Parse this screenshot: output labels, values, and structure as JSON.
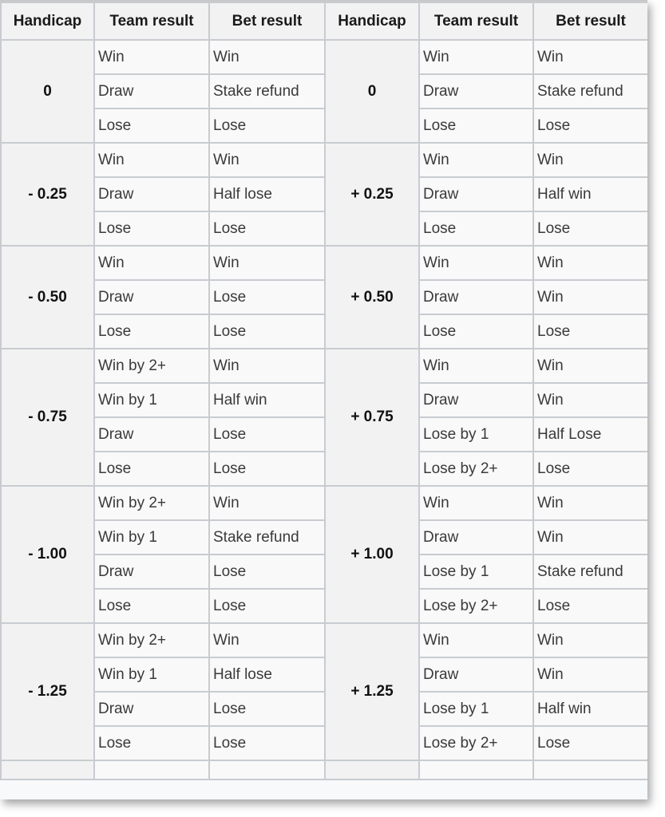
{
  "headers": [
    "Handicap",
    "Team result",
    "Bet result",
    "Handicap",
    "Team result",
    "Bet result"
  ],
  "groups": [
    {
      "left": {
        "handicap": "0",
        "rows": [
          [
            "Win",
            "Win"
          ],
          [
            "Draw",
            "Stake refund"
          ],
          [
            "Lose",
            "Lose"
          ]
        ]
      },
      "right": {
        "handicap": "0",
        "rows": [
          [
            "Win",
            "Win"
          ],
          [
            "Draw",
            "Stake refund"
          ],
          [
            "Lose",
            "Lose"
          ]
        ]
      }
    },
    {
      "left": {
        "handicap": "- 0.25",
        "rows": [
          [
            "Win",
            "Win"
          ],
          [
            "Draw",
            "Half lose"
          ],
          [
            "Lose",
            "Lose"
          ]
        ]
      },
      "right": {
        "handicap": "+ 0.25",
        "rows": [
          [
            "Win",
            "Win"
          ],
          [
            "Draw",
            "Half win"
          ],
          [
            "Lose",
            "Lose"
          ]
        ]
      }
    },
    {
      "left": {
        "handicap": "- 0.50",
        "rows": [
          [
            "Win",
            "Win"
          ],
          [
            "Draw",
            "Lose"
          ],
          [
            "Lose",
            "Lose"
          ]
        ]
      },
      "right": {
        "handicap": "+ 0.50",
        "rows": [
          [
            "Win",
            "Win"
          ],
          [
            "Draw",
            "Win"
          ],
          [
            "Lose",
            "Lose"
          ]
        ]
      }
    },
    {
      "left": {
        "handicap": "- 0.75",
        "rows": [
          [
            "Win by 2+",
            "Win"
          ],
          [
            "Win by 1",
            "Half win"
          ],
          [
            "Draw",
            "Lose"
          ],
          [
            "Lose",
            "Lose"
          ]
        ]
      },
      "right": {
        "handicap": "+ 0.75",
        "rows": [
          [
            "Win",
            "Win"
          ],
          [
            "Draw",
            "Win"
          ],
          [
            "Lose by 1",
            "Half Lose"
          ],
          [
            "Lose by 2+",
            "Lose"
          ]
        ]
      }
    },
    {
      "left": {
        "handicap": "- 1.00",
        "rows": [
          [
            "Win by 2+",
            "Win"
          ],
          [
            "Win by 1",
            "Stake refund"
          ],
          [
            "Draw",
            "Lose"
          ],
          [
            "Lose",
            "Lose"
          ]
        ]
      },
      "right": {
        "handicap": "+ 1.00",
        "rows": [
          [
            "Win",
            "Win"
          ],
          [
            "Draw",
            "Win"
          ],
          [
            "Lose by 1",
            "Stake refund"
          ],
          [
            "Lose by 2+",
            "Lose"
          ]
        ]
      }
    },
    {
      "left": {
        "handicap": "- 1.25",
        "rows": [
          [
            "Win by 2+",
            "Win"
          ],
          [
            "Win by 1",
            "Half lose"
          ],
          [
            "Draw",
            "Lose"
          ],
          [
            "Lose",
            "Lose"
          ]
        ]
      },
      "right": {
        "handicap": "+ 1.25",
        "rows": [
          [
            "Win",
            "Win"
          ],
          [
            "Draw",
            "Win"
          ],
          [
            "Lose by 1",
            "Half win"
          ],
          [
            "Lose by 2+",
            "Lose"
          ]
        ]
      }
    }
  ]
}
